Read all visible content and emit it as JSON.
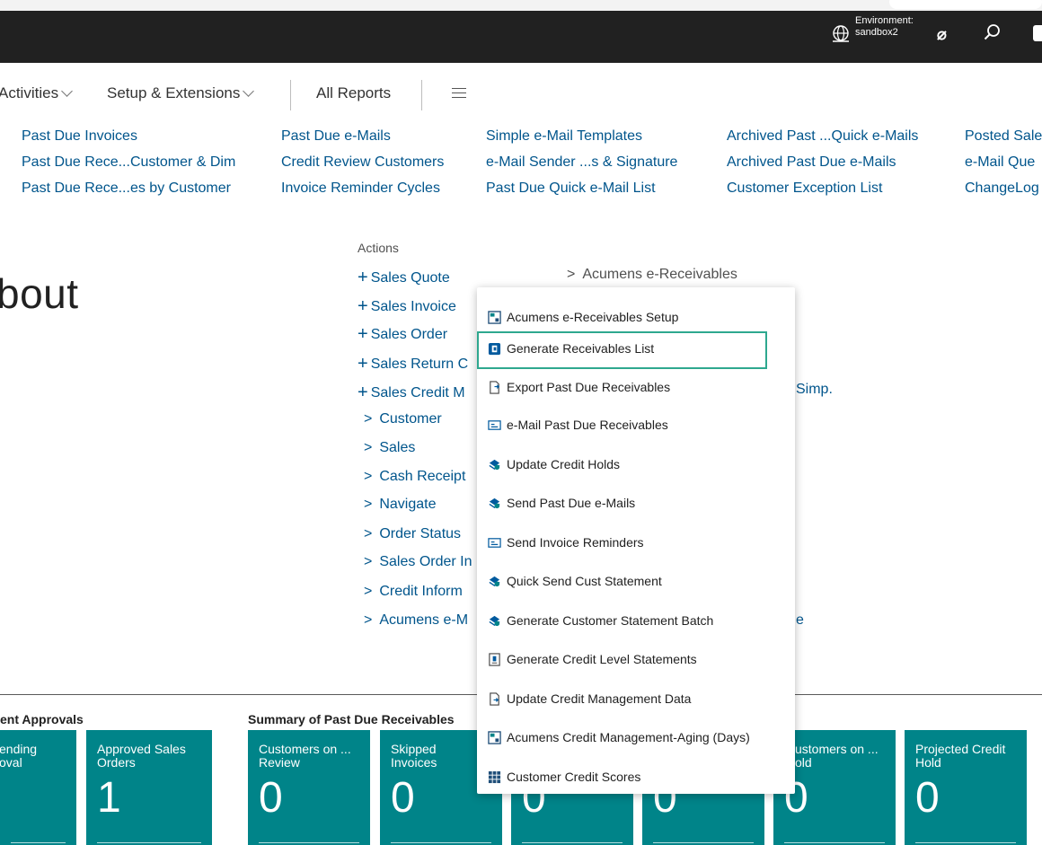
{
  "topbar": {
    "environment_label": "Environment:",
    "environment_value": "sandbox2"
  },
  "nav": {
    "activities": "Activities",
    "setup_extensions": "Setup & Extensions",
    "all_reports": "All Reports"
  },
  "links": {
    "col1": [
      "Past Due Invoices",
      "Past Due Rece...Customer & Dim",
      "Past Due Rece...es by Customer"
    ],
    "col2": [
      "Past Due e-Mails",
      "Credit Review Customers",
      "Invoice Reminder Cycles"
    ],
    "col3": [
      "Simple e-Mail Templates",
      "e-Mail Sender ...s & Signature",
      "Past Due Quick e-Mail List"
    ],
    "col4": [
      "Archived Past ...Quick e-Mails",
      "Archived Past Due e-Mails",
      "Customer Exception List"
    ],
    "col5": [
      "Posted Sale",
      "e-Mail Que",
      "ChangeLog"
    ]
  },
  "heading": "bout",
  "actions": {
    "label": "Actions",
    "new_items": [
      "Sales Quote",
      "Sales Invoice",
      "Sales Order",
      "Sales Return C",
      "Sales Credit M"
    ],
    "groups": [
      "Customer",
      "Sales",
      "Cash Receipt",
      "Navigate",
      "Order Status",
      "Sales Order In",
      "Credit Inform",
      "Acumens e-M"
    ],
    "right_header": "Acumens e-Receivables",
    "partial_imp": "Simp.",
    "partial_e": "e"
  },
  "dropdown": {
    "items": [
      {
        "label": "Acumens e-Receivables Setup",
        "icon": "setup-icon"
      },
      {
        "label": "Generate Receivables List",
        "icon": "report-icon"
      },
      {
        "label": "Export Past Due Receivables",
        "icon": "export-icon"
      },
      {
        "label": "e-Mail Past Due Receivables",
        "icon": "email-icon"
      },
      {
        "label": "Update Credit Holds",
        "icon": "process-icon"
      },
      {
        "label": "Send Past Due e-Mails",
        "icon": "process-icon"
      },
      {
        "label": "Send Invoice Reminders",
        "icon": "email-icon"
      },
      {
        "label": "Quick Send Cust Statement",
        "icon": "process-icon"
      },
      {
        "label": "Generate Customer Statement Batch",
        "icon": "process-icon"
      },
      {
        "label": "Generate Credit Level Statements",
        "icon": "statement-icon"
      },
      {
        "label": "Update Credit Management Data",
        "icon": "document-icon"
      },
      {
        "label": "Acumens Credit Management-Aging (Days)",
        "icon": "setup-icon"
      },
      {
        "label": "Customer Credit Scores",
        "icon": "grid-icon"
      }
    ]
  },
  "cues": {
    "group1_title": "ent Approvals",
    "group2_title": "Summary of Past Due Receivables",
    "tiles": [
      {
        "label_line1": "ending",
        "label_line2": "oval",
        "value": ""
      },
      {
        "label_line1": "Approved Sales",
        "label_line2": "Orders",
        "value": "1"
      },
      {
        "label_line1": "Customers on ...",
        "label_line2": "Review",
        "value": "0"
      },
      {
        "label_line1": "Skipped",
        "label_line2": "Invoices",
        "value": "0"
      },
      {
        "label_line1": "",
        "label_line2": "",
        "value": "0"
      },
      {
        "label_line1": "",
        "label_line2": "",
        "value": "0"
      },
      {
        "label_line1": "ustomers on ...",
        "label_line2": "old",
        "value": "0"
      },
      {
        "label_line1": "Projected Credit",
        "label_line2": "Hold",
        "value": "0"
      }
    ]
  },
  "colors": {
    "tile": "#008489",
    "link": "#00558c",
    "highlight": "#2ea88f",
    "topbar": "#212121"
  }
}
